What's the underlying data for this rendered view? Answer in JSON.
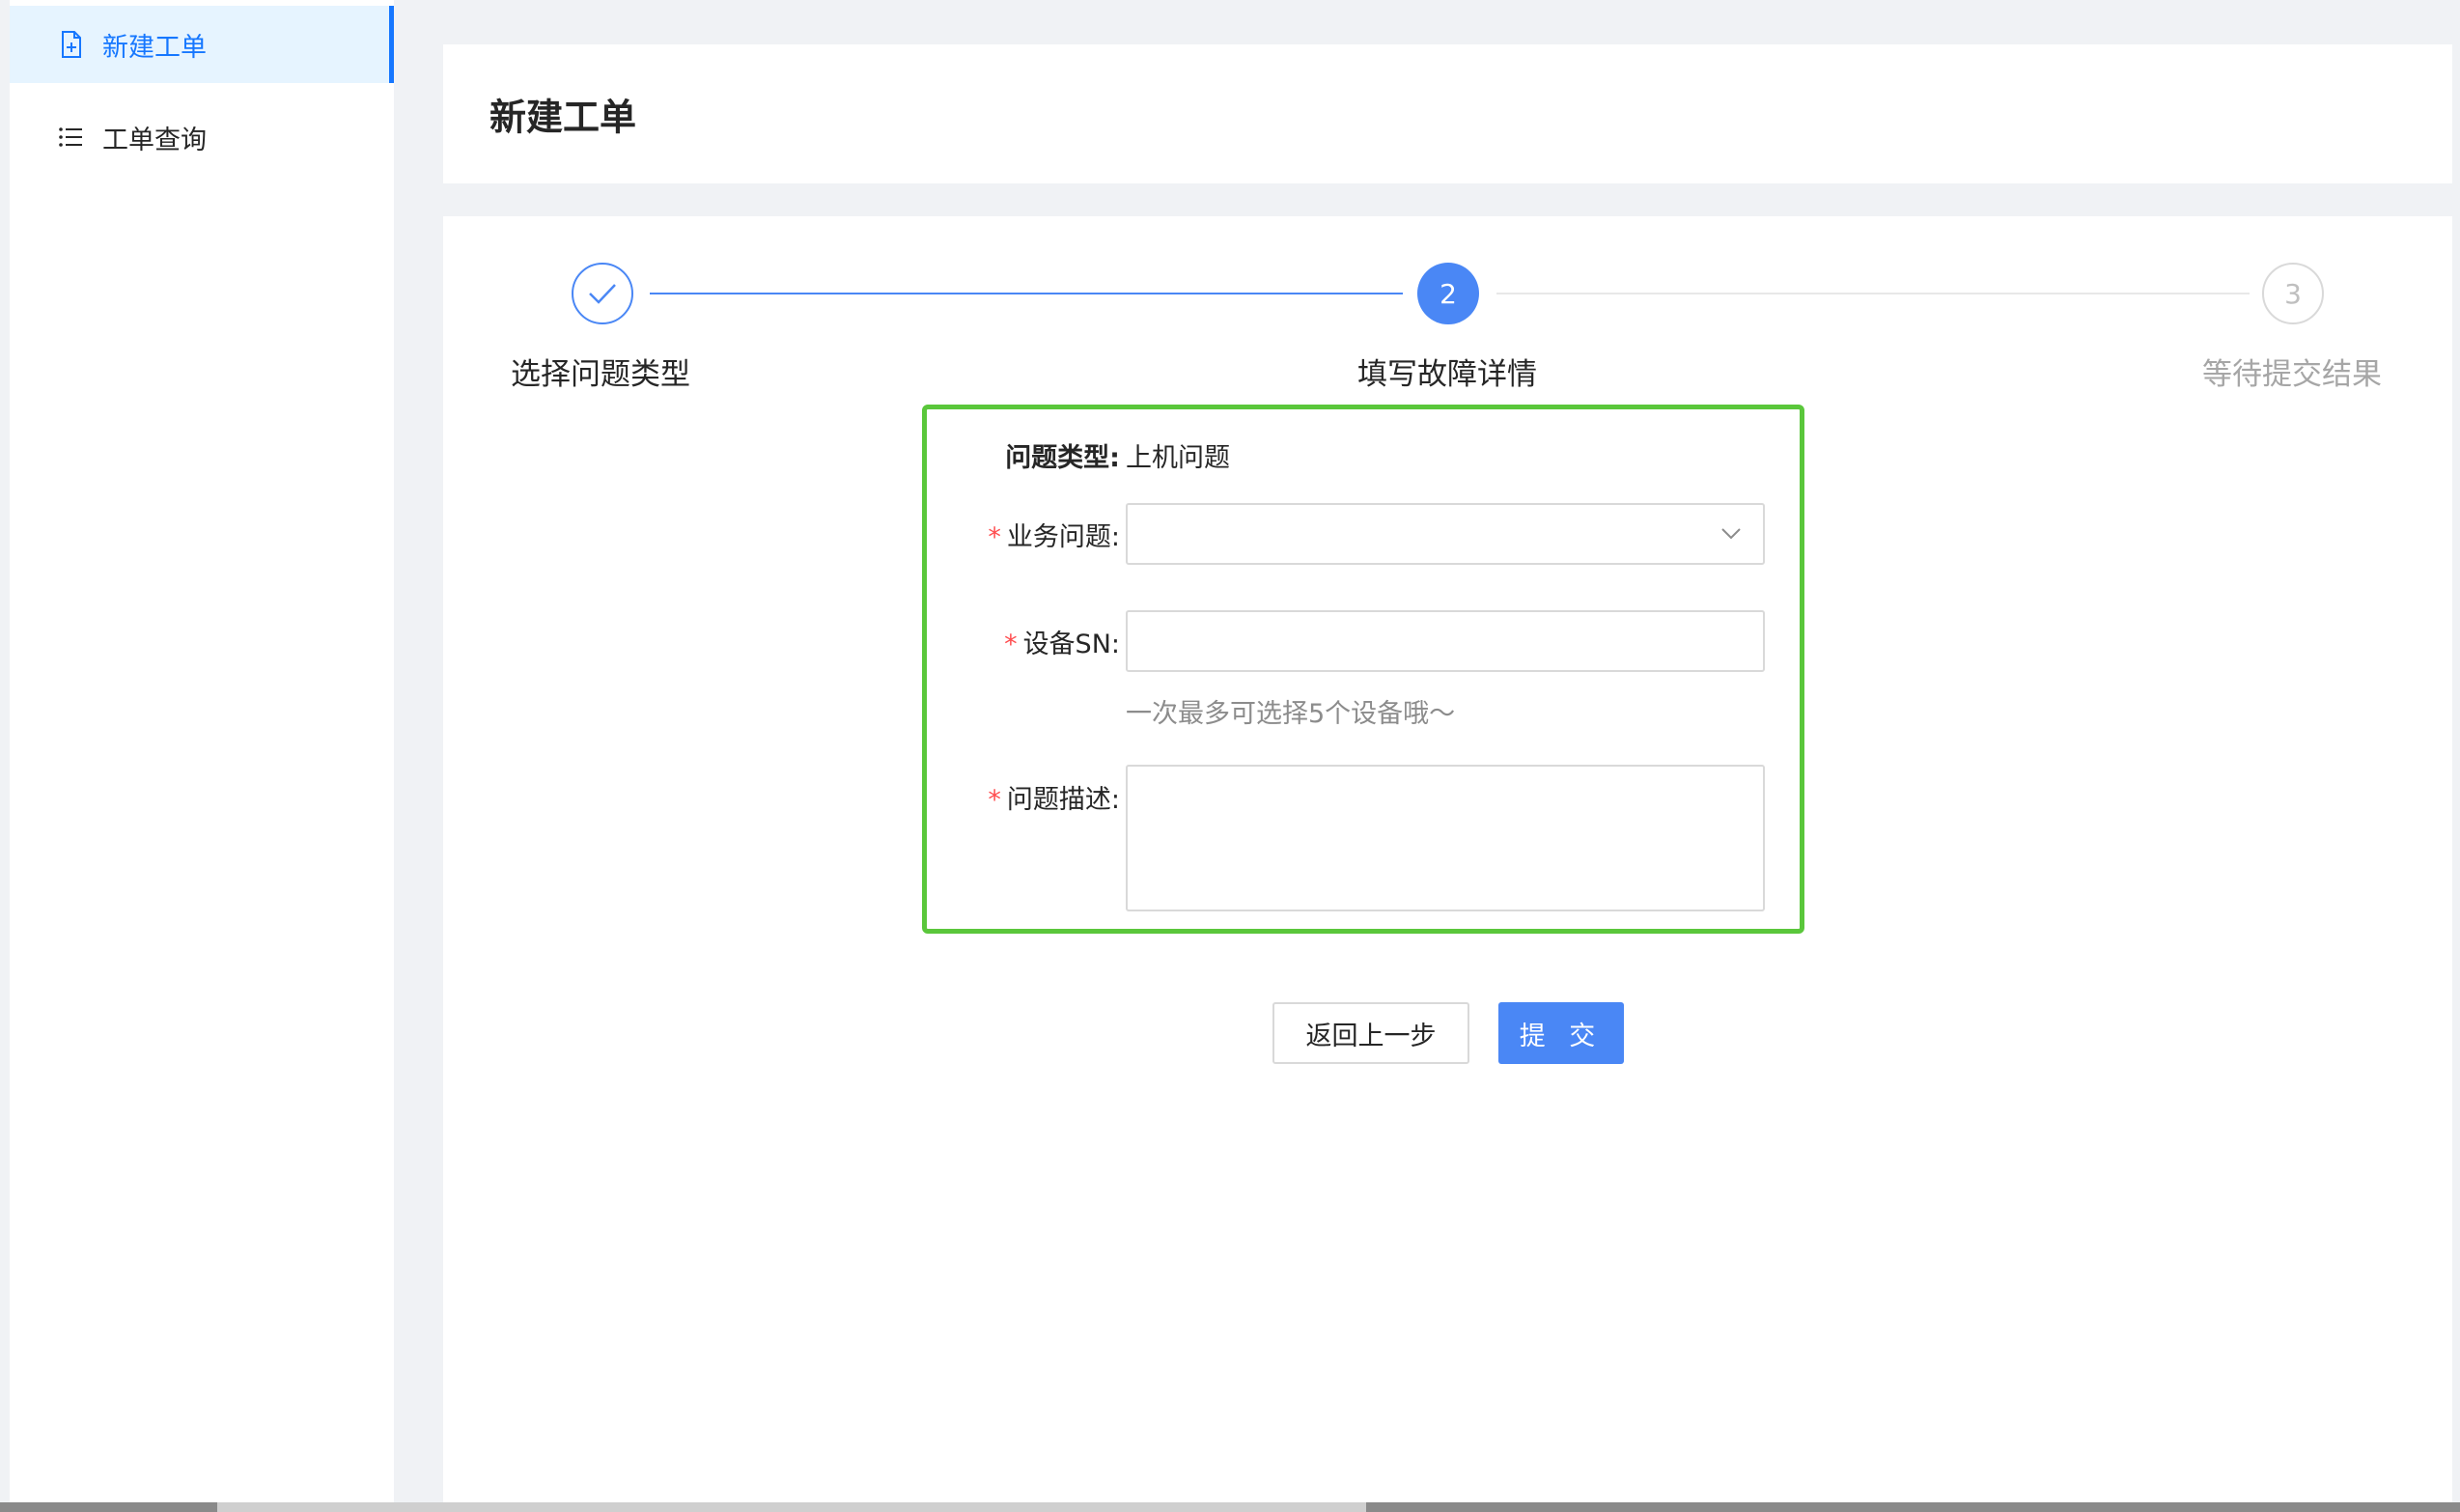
{
  "sidebar": {
    "items": [
      {
        "label": "新建工单",
        "icon": "file-add-icon",
        "active": true
      },
      {
        "label": "工单查询",
        "icon": "list-icon",
        "active": false
      }
    ]
  },
  "header": {
    "title": "新建工单"
  },
  "steps": [
    {
      "title": "选择问题类型",
      "status": "finished",
      "icon": "check-icon"
    },
    {
      "title": "填写故障详情",
      "status": "current",
      "number": "2"
    },
    {
      "title": "等待提交结果",
      "status": "waiting",
      "number": "3"
    }
  ],
  "form": {
    "issue_type": {
      "label": "问题类型:",
      "value": "上机问题"
    },
    "business_issue": {
      "required_mark": "*",
      "label": "业务问题:",
      "value": ""
    },
    "device_sn": {
      "required_mark": "*",
      "label": "设备SN:",
      "value": "",
      "helper": "一次最多可选择5个设备哦～"
    },
    "description": {
      "required_mark": "*",
      "label": "问题描述:",
      "value": ""
    }
  },
  "actions": {
    "back_label": "返回上一步",
    "submit_label": "提 交"
  },
  "colors": {
    "primary": "#4a87f5",
    "highlight_border": "#5ac73b",
    "required": "#ff4d4f"
  }
}
